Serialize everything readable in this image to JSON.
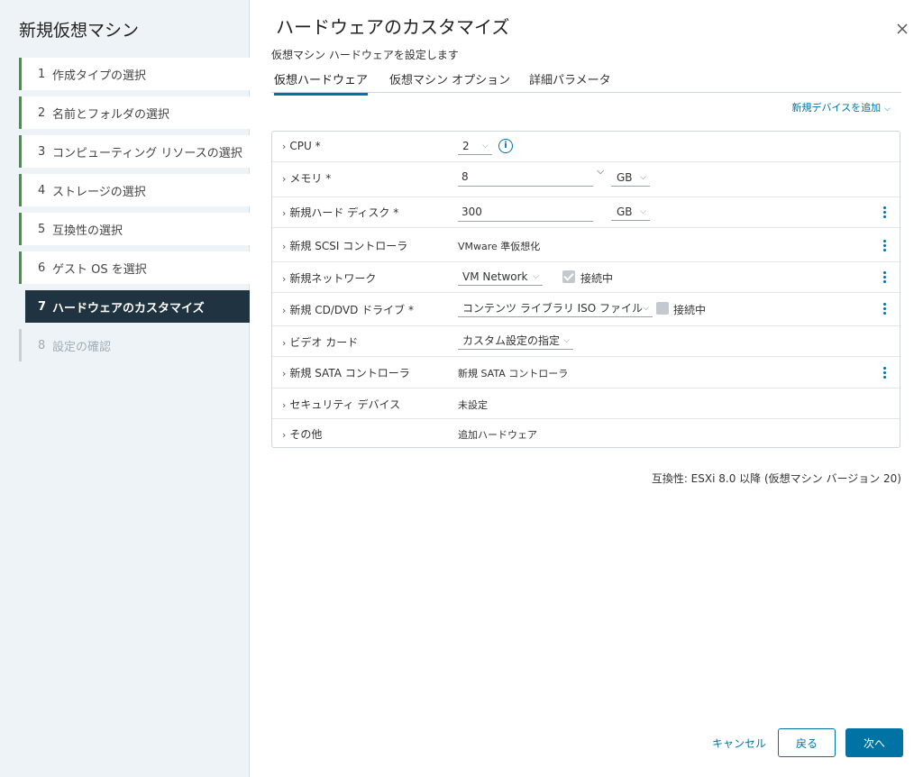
{
  "wizard": {
    "title": "新規仮想マシン",
    "steps": [
      {
        "num": "1",
        "label": "作成タイプの選択"
      },
      {
        "num": "2",
        "label": "名前とフォルダの選択"
      },
      {
        "num": "3",
        "label": "コンピューティング リソースの選択"
      },
      {
        "num": "4",
        "label": "ストレージの選択"
      },
      {
        "num": "5",
        "label": "互換性の選択"
      },
      {
        "num": "6",
        "label": "ゲスト OS を選択"
      },
      {
        "num": "7",
        "label": "ハードウェアのカスタマイズ"
      },
      {
        "num": "8",
        "label": "設定の確認"
      }
    ]
  },
  "page": {
    "title": "ハードウェアのカスタマイズ",
    "subtitle": "仮想マシン ハードウェアを設定します",
    "tabs": [
      "仮想ハードウェア",
      "仮想マシン オプション",
      "詳細パラメータ"
    ],
    "add_device": "新規デバイスを追加"
  },
  "hardware": {
    "cpu": {
      "label": "CPU *",
      "value": "2"
    },
    "memory": {
      "label": "メモリ *",
      "value": "8",
      "unit": "GB"
    },
    "disk": {
      "label": "新規ハード ディスク *",
      "value": "300",
      "unit": "GB"
    },
    "scsi": {
      "label": "新規 SCSI コントローラ",
      "value": "VMware 準仮想化"
    },
    "network": {
      "label": "新規ネットワーク",
      "value": "VM Network",
      "connected_label": "接続中"
    },
    "cddvd": {
      "label": "新規 CD/DVD ドライブ *",
      "value": "コンテンツ ライブラリ ISO ファイル",
      "connected_label": "接続中"
    },
    "video": {
      "label": "ビデオ カード",
      "value": "カスタム設定の指定"
    },
    "sata": {
      "label": "新規 SATA コントローラ",
      "value": "新規 SATA コントローラ"
    },
    "security": {
      "label": "セキュリティ デバイス",
      "value": "未設定"
    },
    "other": {
      "label": "その他",
      "value": "追加ハードウェア"
    }
  },
  "compatibility": "互換性: ESXi 8.0 以降 (仮想マシン バージョン 20)",
  "footer": {
    "cancel": "キャンセル",
    "back": "戻る",
    "next": "次へ"
  },
  "colors": {
    "accent": "#0072a3",
    "active_step_bg": "#1f3341",
    "step_done_bar": "#3d9a3a"
  }
}
